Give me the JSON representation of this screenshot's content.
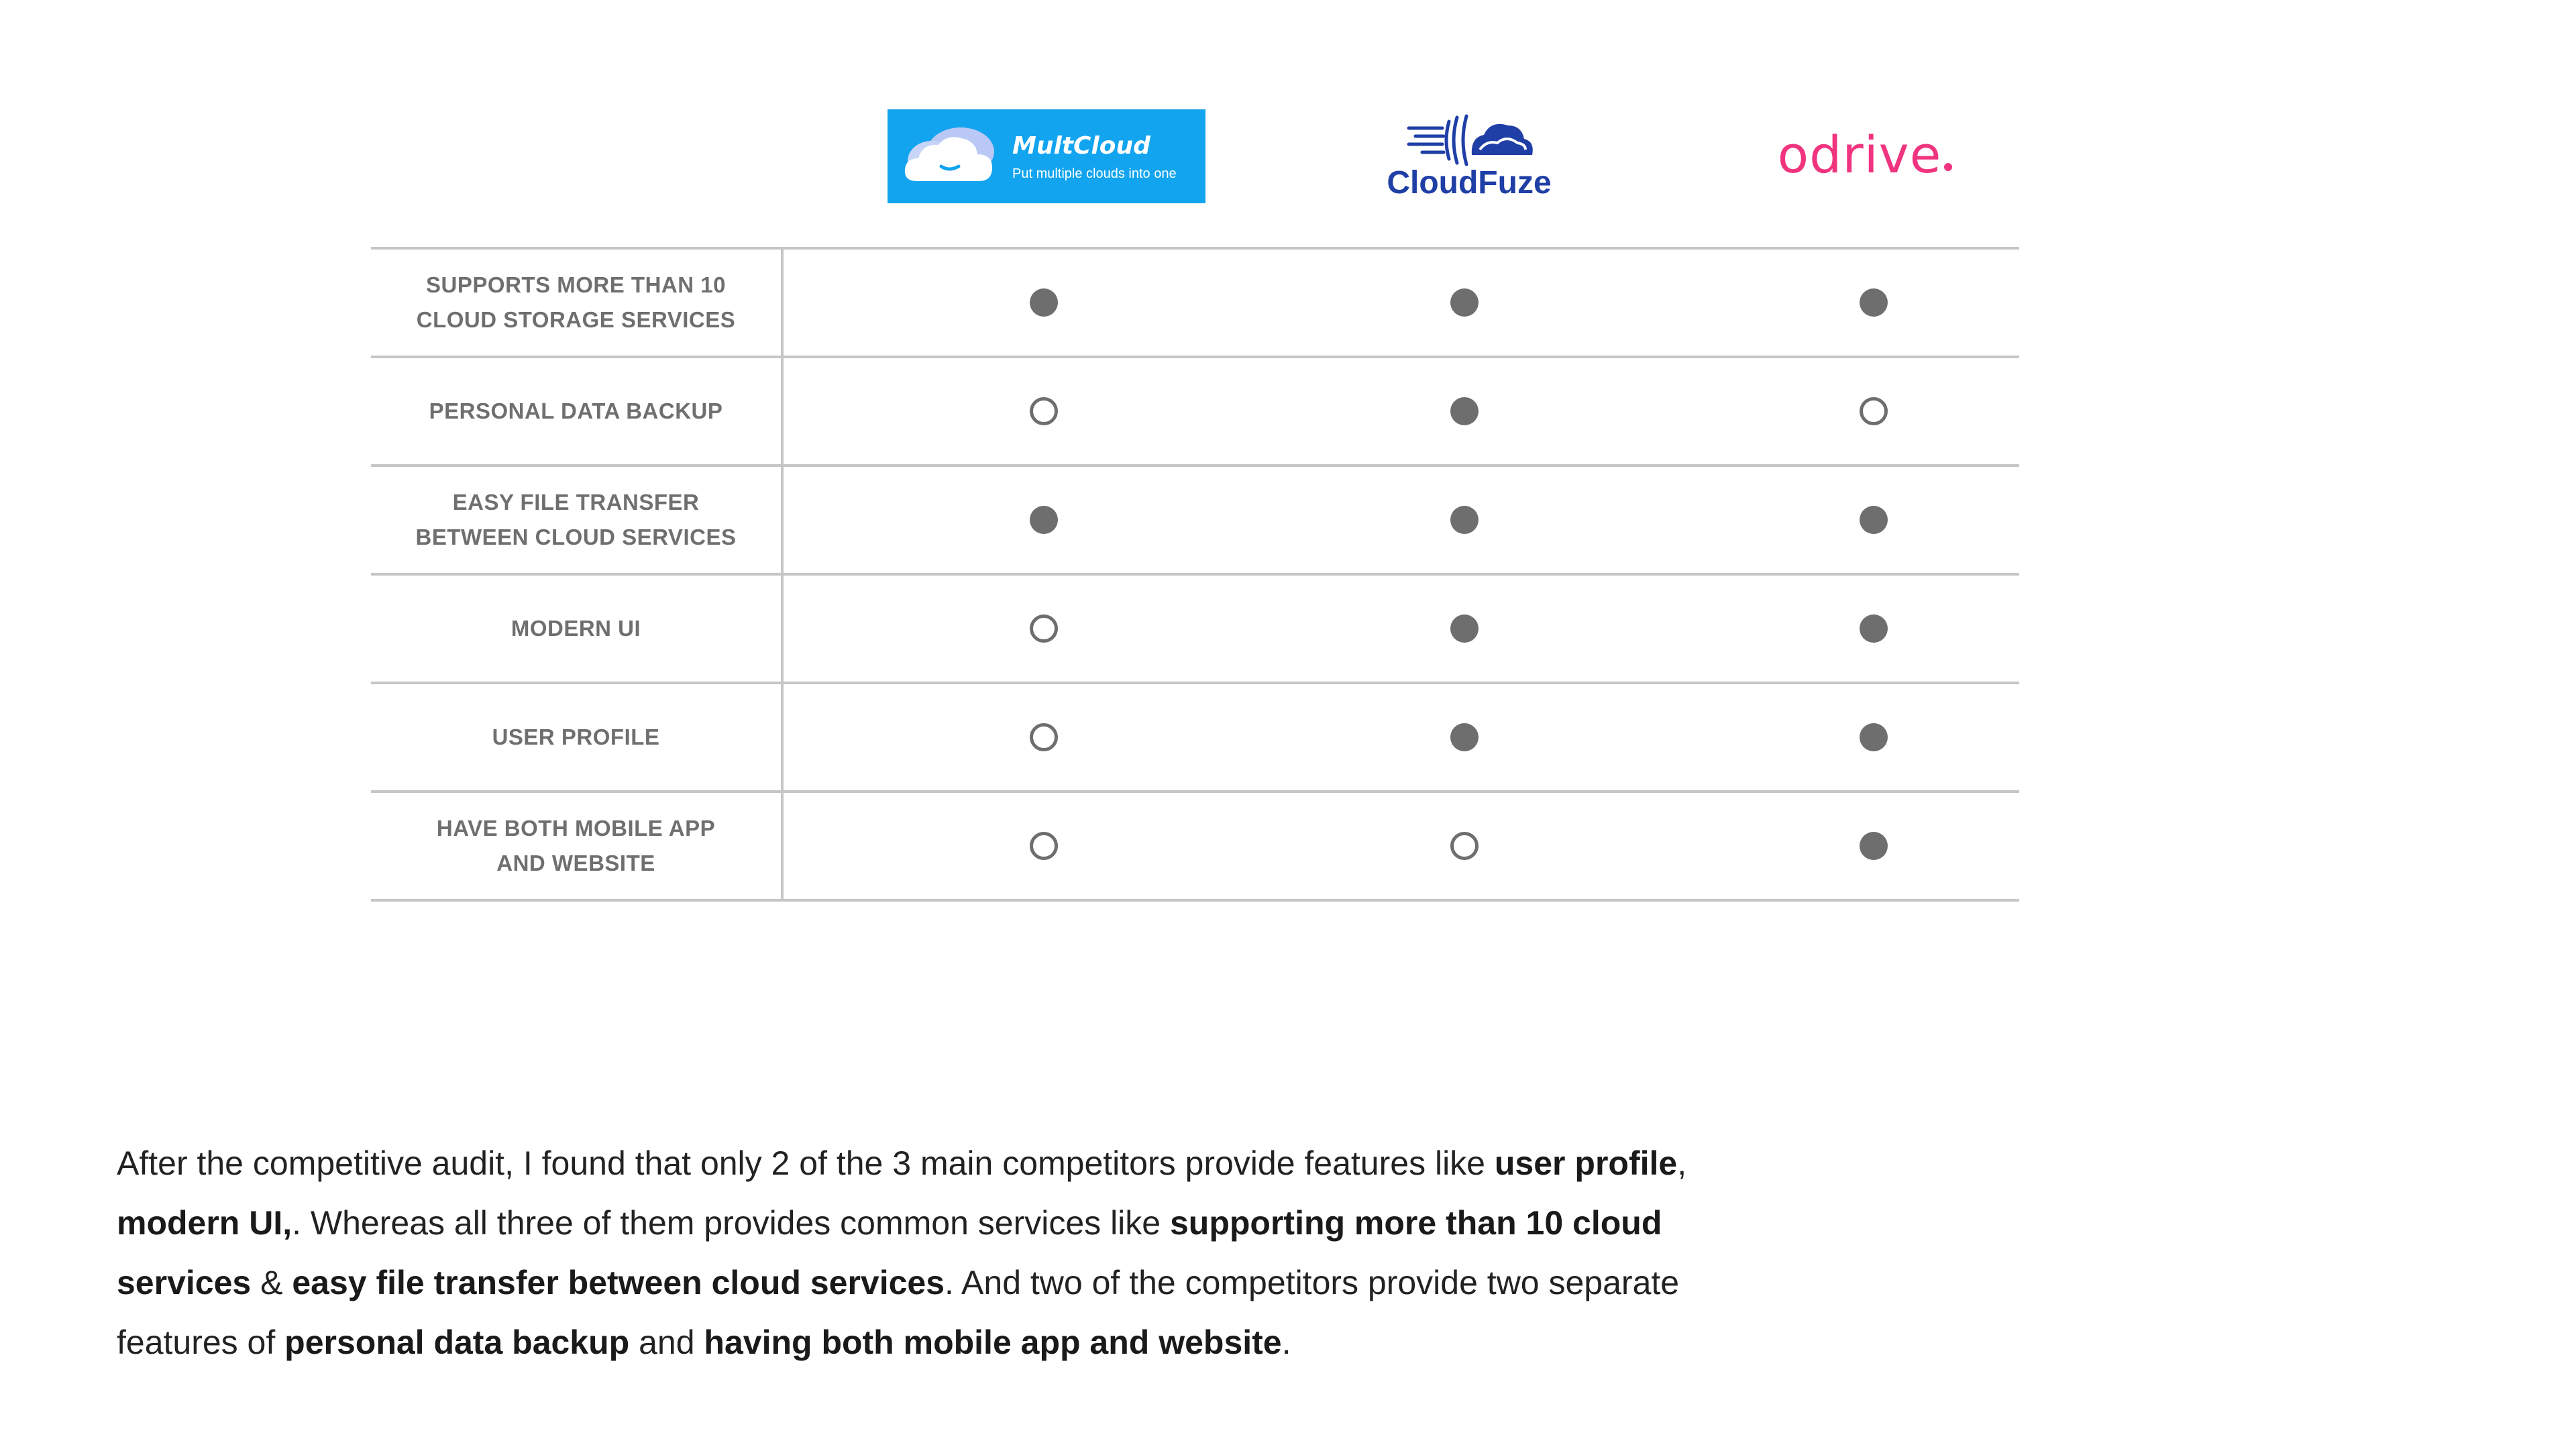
{
  "logos": {
    "multcloud": {
      "name": "MultCloud",
      "tagline": "Put multiple clouds into one",
      "color": "#12a4ef"
    },
    "cloudfuze": {
      "name": "CloudFuze",
      "color": "#1f3fa6"
    },
    "odrive": {
      "name": "odrive",
      "color": "#f0347f"
    }
  },
  "table": {
    "rows": [
      {
        "label": "SUPPORTS MORE THAN 10\nCLOUD STORAGE SERVICES",
        "marks": [
          "filled",
          "filled",
          "filled"
        ]
      },
      {
        "label": "PERSONAL DATA BACKUP",
        "marks": [
          "empty",
          "filled",
          "empty"
        ]
      },
      {
        "label": "EASY FILE TRANSFER\nBETWEEN CLOUD SERVICES",
        "marks": [
          "filled",
          "filled",
          "filled"
        ]
      },
      {
        "label": "MODERN UI",
        "marks": [
          "empty",
          "filled",
          "filled"
        ]
      },
      {
        "label": "USER PROFILE",
        "marks": [
          "empty",
          "filled",
          "filled"
        ]
      },
      {
        "label": "HAVE BOTH MOBILE APP\nAND WEBSITE",
        "marks": [
          "empty",
          "empty",
          "filled"
        ]
      }
    ],
    "mark_color": "#6e6e6e",
    "line_color": "#c6c6c6"
  },
  "summary": {
    "parts": [
      {
        "text": "After the competitive audit, I found that only 2 of the 3 main competitors provide features like ",
        "bold": false
      },
      {
        "text": "user profile",
        "bold": true
      },
      {
        "text": ", ",
        "bold": false
      },
      {
        "text": "modern UI,",
        "bold": true
      },
      {
        "text": ". Whereas all three of them provides common services like ",
        "bold": false
      },
      {
        "text": "supporting more than 10 cloud services",
        "bold": true
      },
      {
        "text": " & ",
        "bold": false
      },
      {
        "text": "easy file transfer between cloud services",
        "bold": true
      },
      {
        "text": ". And two of the competitors provide two separate features of ",
        "bold": false
      },
      {
        "text": "personal data backup",
        "bold": true
      },
      {
        "text": " and ",
        "bold": false
      },
      {
        "text": "having both mobile app and website",
        "bold": true
      },
      {
        "text": ".",
        "bold": false
      }
    ]
  }
}
